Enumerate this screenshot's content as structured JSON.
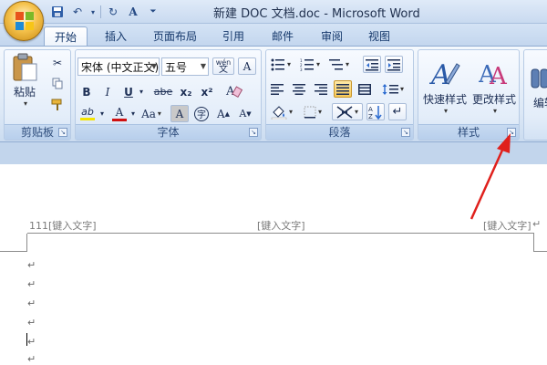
{
  "window": {
    "title": "新建 DOC 文档.doc - Microsoft Word"
  },
  "tabs": [
    "开始",
    "插入",
    "页面布局",
    "引用",
    "邮件",
    "审阅",
    "视图"
  ],
  "ribbon": {
    "clipboard": {
      "label": "剪贴板",
      "paste": "粘贴"
    },
    "font": {
      "label": "字体",
      "font_name": "宋体 (中文正文)",
      "font_size": "五号",
      "bold": "B",
      "italic": "I",
      "underline": "U",
      "strike": "abe",
      "subscript": "x₂",
      "superscript": "x²",
      "font_color": "A",
      "change_case": "Aa",
      "char_shading": "A",
      "enclose": "字",
      "grow": "A",
      "shrink": "A",
      "clear": "A",
      "phonetic": "wén",
      "highlight": "ab"
    },
    "paragraph": {
      "label": "段落"
    },
    "styles": {
      "label": "样式",
      "quick_styles": "快速样式",
      "change_styles": "更改样式"
    },
    "editing": {
      "label": "编辑"
    }
  },
  "document": {
    "header_left": "111[键入文字]",
    "header_center": "[键入文字]",
    "header_right": "[键入文字]",
    "para_mark": "↵"
  },
  "colors": {
    "annotation_arrow": "#e0201c",
    "highlight_yellow": "#f5e400",
    "font_red": "#d01010"
  }
}
